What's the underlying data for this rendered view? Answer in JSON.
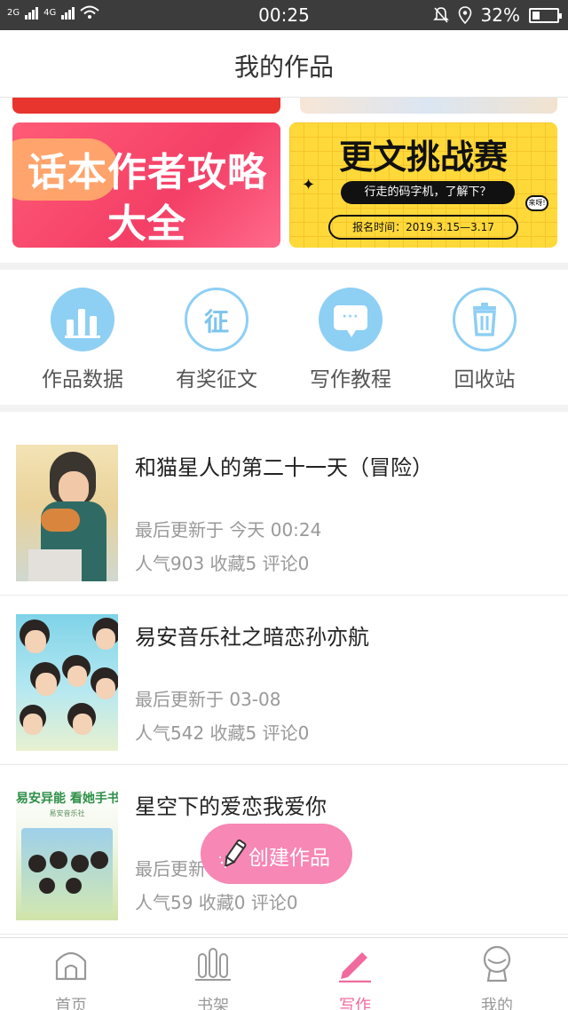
{
  "status_bar": {
    "network_left": "2G",
    "network_right": "4G",
    "time": "00:25",
    "battery": "32%",
    "battery_level": 0.32
  },
  "header": {
    "title": "我的作品"
  },
  "banners": [
    {
      "id": "guide",
      "line1": "话本作者攻略",
      "line2": "大全"
    },
    {
      "id": "challenge",
      "title": "更文挑战赛",
      "subtitle": "行走的码字机，了解下？",
      "date": "报名时间：2019.3.15—3.17",
      "badge": "来呀!"
    }
  ],
  "quick_actions": [
    {
      "label": "作品数据",
      "icon": "bar-chart-icon"
    },
    {
      "label": "有奖征文",
      "icon": "zheng-icon",
      "glyph": "征"
    },
    {
      "label": "写作教程",
      "icon": "chat-bubble-icon",
      "glyph": "···"
    },
    {
      "label": "回收站",
      "icon": "trash-icon"
    }
  ],
  "works": [
    {
      "title": "和猫星人的第二十一天（冒险）",
      "updated": "最后更新于 今天 00:24",
      "stats": "人气903  收藏5  评论0"
    },
    {
      "title": "易安音乐社之暗恋孙亦航",
      "updated": "最后更新于 03-08",
      "stats": "人气542  收藏5  评论0"
    },
    {
      "title": "星空下的爱恋我爱你",
      "updated": "最后更新于 03-08",
      "stats": "人气59  收藏0  评论0",
      "cover_text": "易安异能 看她手书",
      "cover_subtext": "易安音乐社"
    }
  ],
  "fab": {
    "label": "创建作品",
    "icon": "pencil-icon",
    "color": "#f787b5"
  },
  "tabbar": [
    {
      "label": "首页",
      "icon": "home-icon",
      "active": false
    },
    {
      "label": "书架",
      "icon": "bookshelf-icon",
      "active": false
    },
    {
      "label": "写作",
      "icon": "pencil-icon",
      "active": true
    },
    {
      "label": "我的",
      "icon": "user-icon",
      "active": false
    }
  ],
  "colors": {
    "accent_pink": "#f06a9e",
    "icon_blue": "#8ecff4"
  }
}
